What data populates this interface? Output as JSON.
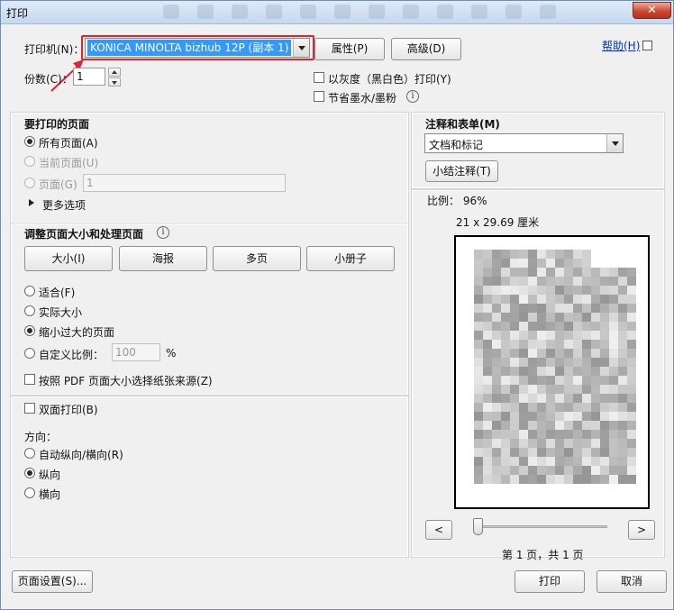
{
  "window": {
    "title": "打印",
    "close_label": "✕"
  },
  "printer": {
    "label": "打印机(N)：",
    "selected": "KONICA MINOLTA bizhub 12P (副本 1)",
    "properties_button": "属性(P)",
    "advanced_button": "高级(D)",
    "help_link": "帮助(H)",
    "copies_label": "份数(C)：",
    "copies_value": "1",
    "grayscale_label": "以灰度（黑白色）打印(Y)",
    "save_ink_label": "节省墨水/墨粉"
  },
  "pages_to_print": {
    "title": "要打印的页面",
    "all_pages": "所有页面(A)",
    "current_page": "当前页面(U)",
    "pages_label": "页面(G)",
    "pages_value": "1",
    "more_options": "更多选项"
  },
  "page_sizing": {
    "title": "调整页面大小和处理页面",
    "buttons": [
      "大小(I)",
      "海报",
      "多页",
      "小册子"
    ],
    "fit": "适合(F)",
    "actual_size": "实际大小",
    "shrink_oversized": "缩小过大的页面",
    "custom_scale": "自定义比例：",
    "custom_scale_value": "100",
    "percent_sign": "%",
    "choose_paper_source": "按照 PDF 页面大小选择纸张来源(Z)"
  },
  "duplex": {
    "label": "双面打印(B)",
    "orientation_title": "方向：",
    "auto_orientation": "自动纵向/横向(R)",
    "portrait": "纵向",
    "landscape": "横向"
  },
  "comments_forms": {
    "title": "注释和表单(M)",
    "selected": "文档和标记",
    "summarize_button": "小结注释(T)"
  },
  "preview": {
    "scale_label": "比例： 96%",
    "paper_size": "21 x 29.69 厘米",
    "prev_button": "<",
    "next_button": ">",
    "page_info": "第 1 页，共 1 页"
  },
  "footer": {
    "page_setup_button": "页面设置(S)...",
    "print_button": "打印",
    "cancel_button": "取消"
  },
  "colors": {
    "selection_blue": "#3399ff",
    "highlight_red": "#e0242f",
    "link_blue": "#0033cc"
  }
}
